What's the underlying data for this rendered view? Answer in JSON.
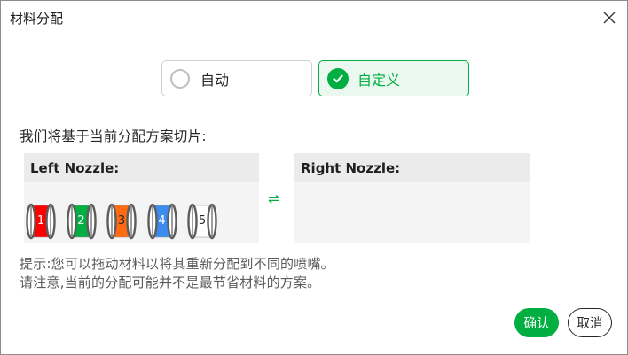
{
  "dialog": {
    "title": "材料分配",
    "close_icon": "close-icon"
  },
  "mode": {
    "auto_label": "自动",
    "custom_label": "自定义",
    "selected": "custom",
    "accent_color": "#00ae42"
  },
  "description": "我们将基于当前分配方案切片:",
  "nozzles": {
    "left_title": "Left Nozzle:",
    "right_title": "Right Nozzle:",
    "swap_icon": "swap-arrows-icon",
    "swap_glyph": "⇌"
  },
  "spools": [
    {
      "number": "1",
      "color": "#ff0000",
      "text_color": "#ffffff"
    },
    {
      "number": "2",
      "color": "#00ae42",
      "text_color": "#ffffff"
    },
    {
      "number": "3",
      "color": "#ff6a13",
      "text_color": "#262626"
    },
    {
      "number": "4",
      "color": "#3c8cf0",
      "text_color": "#ffffff"
    },
    {
      "number": "5",
      "color": "#ffffff",
      "text_color": "#262626"
    }
  ],
  "hint": {
    "line1": "提示:您可以拖动材料以将其重新分配到不同的喷嘴。",
    "line2": "请注意,当前的分配可能并不是最节省材料的方案。"
  },
  "buttons": {
    "confirm": "确认",
    "cancel": "取消"
  }
}
